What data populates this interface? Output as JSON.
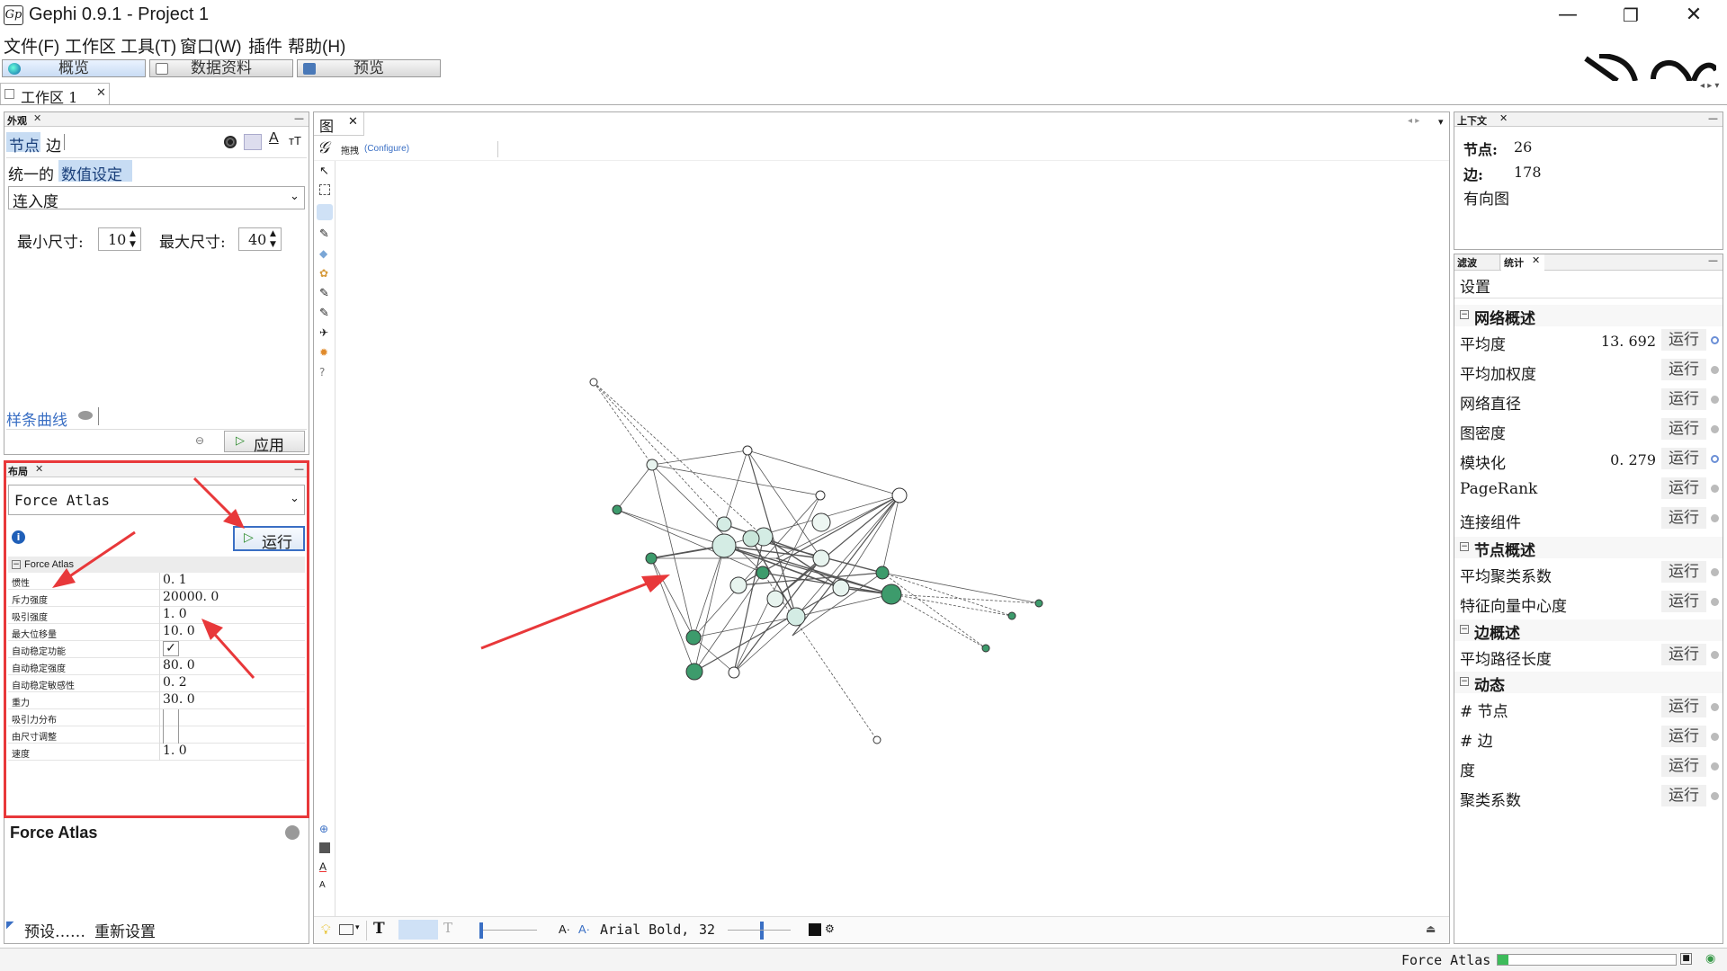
{
  "window": {
    "title": "Gephi 0.9.1 - Project 1",
    "logo": "Gp",
    "controls": {
      "minimize": "—",
      "maximize": "❐",
      "close": "✕"
    }
  },
  "menu": [
    "文件(F)",
    "工作区",
    "工具(T)",
    "窗口(W)",
    "插件",
    "帮助(H)"
  ],
  "modes": [
    "概览",
    "数据资料",
    "预览"
  ],
  "workspace_tab": {
    "label": "工作区 1",
    "close": "✕"
  },
  "appearance": {
    "title": "外观",
    "tabs": {
      "nodes": "节点",
      "edges": "边"
    },
    "subtabs": {
      "unique": "统一的",
      "ranking": "数值设定"
    },
    "attribute": "连入度",
    "min_label": "最小尺寸:",
    "min_value": "10",
    "max_label": "最大尺寸:",
    "max_value": "40",
    "spline": "样条曲线",
    "apply": "应用"
  },
  "layout": {
    "title": "布局",
    "algorithm": "Force Atlas",
    "run": "运行",
    "section": "Force Atlas",
    "properties": [
      {
        "name": "惯性",
        "value": "0. 1"
      },
      {
        "name": "斥力强度",
        "value": "20000. 0"
      },
      {
        "name": "吸引强度",
        "value": "1. 0"
      },
      {
        "name": "最大位移量",
        "value": "10. 0"
      },
      {
        "name": "自动稳定功能",
        "value": "✓"
      },
      {
        "name": "自动稳定强度",
        "value": "80. 0"
      },
      {
        "name": "自动稳定敏感性",
        "value": "0. 2"
      },
      {
        "name": "重力",
        "value": "30. 0"
      },
      {
        "name": "吸引力分布",
        "value": ""
      },
      {
        "name": "由尺寸调整",
        "value": ""
      },
      {
        "name": "速度",
        "value": "1. 0"
      }
    ],
    "description_title": "Force Atlas",
    "presets": "预设……",
    "reset": "重新设置"
  },
  "graph": {
    "tab": "图",
    "toolbar_drag": "拖拽",
    "toolbar_configure": "(Configure)",
    "font": "Arial Bold,",
    "font_size": "32"
  },
  "context": {
    "title": "上下文",
    "nodes_label": "节点:",
    "nodes_value": "26",
    "edges_label": "边:",
    "edges_value": "178",
    "graph_type": "有向图"
  },
  "statistics": {
    "tab_filter": "滤波",
    "tab_stats": "统计",
    "settings": "设置",
    "run_label": "运行",
    "sections": [
      {
        "label": "网络概述",
        "items": [
          {
            "name": "平均度",
            "value": "13. 692",
            "info": true
          },
          {
            "name": "平均加权度",
            "value": "",
            "info": false
          },
          {
            "name": "网络直径",
            "value": "",
            "info": false
          },
          {
            "name": "图密度",
            "value": "",
            "info": false
          },
          {
            "name": "模块化",
            "value": "0. 279",
            "info": true
          },
          {
            "name": "PageRank",
            "value": "",
            "info": false
          },
          {
            "name": "连接组件",
            "value": "",
            "info": false
          }
        ]
      },
      {
        "label": "节点概述",
        "items": [
          {
            "name": "平均聚类系数",
            "value": "",
            "info": false
          },
          {
            "name": "特征向量中心度",
            "value": "",
            "info": false
          }
        ]
      },
      {
        "label": "边概述",
        "items": [
          {
            "name": "平均路径长度",
            "value": "",
            "info": false
          }
        ]
      },
      {
        "label": "动态",
        "items": [
          {
            "name": "# 节点",
            "value": "",
            "info": false
          },
          {
            "name": "# 边",
            "value": "",
            "info": false
          },
          {
            "name": "度",
            "value": "",
            "info": false
          },
          {
            "name": "聚类系数",
            "value": "",
            "info": false
          }
        ]
      }
    ]
  },
  "status": {
    "layout_name": "Force Atlas"
  },
  "colors": {
    "accent_blue": "#3a6fc4",
    "annotation_red": "#e8383a",
    "node_green": "#3d9b6c",
    "node_light": "#d4ece4"
  }
}
